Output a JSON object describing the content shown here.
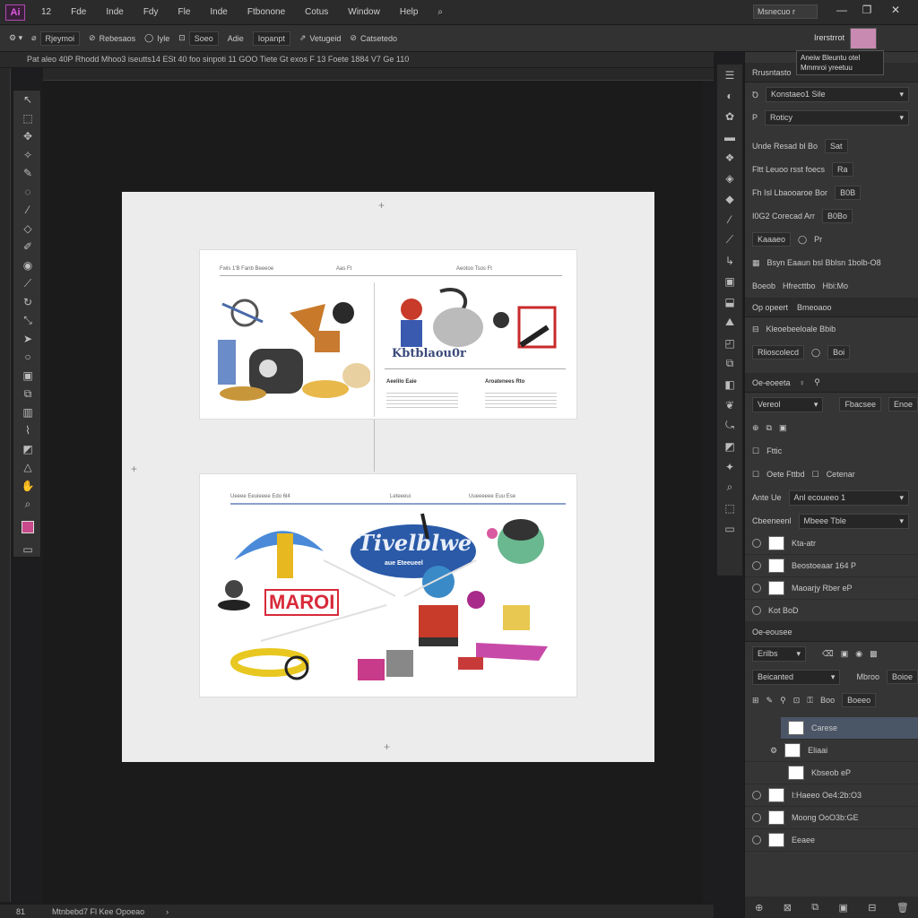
{
  "menubar": {
    "logo": "Ai",
    "items": [
      "12",
      "Fde",
      "Inde",
      "Fdy",
      "Fle",
      "Inde",
      "Ftbonone",
      "Cotus",
      "Window",
      "Help"
    ],
    "workspace": "Msnecuo r",
    "controls": [
      "—",
      "❐",
      "✕"
    ]
  },
  "options": {
    "items": [
      "Rjeymoi",
      "Rebesaos",
      "Iyle",
      "Soeo",
      "Adie",
      "Iopanpt",
      "Vetugeid",
      "Catsetedo"
    ],
    "right_label": "Irerstrrot"
  },
  "tooltip": {
    "line1": "Aneiw Bleuntu otel",
    "line2": "Mmmroi yreetuu"
  },
  "doc_tab": "Pat aleo 40P Rhodd Mhoo3 iseutts14 ESt 40 foo sinpoti 11 GOO Tiete Gt exos F 13 Foete 1884 V7 Ge 110",
  "artboard": {
    "card1": {
      "head_left": "Fwls 1'B Fanb Beeeoe",
      "head_mid": "Aas Ft",
      "head_right": "Aeotoo Tsos Ft",
      "title": "Kbtblaou0r",
      "col1_title": "Aeelilo Eaie",
      "col2_title": "Aroatenees Rto"
    },
    "card2": {
      "head_left": "Ueeee Eeuieeee Edo 6l4",
      "head_mid": "Leteeeui",
      "head_right": "Uueeeeee Euu Ese",
      "logo_text": "Tivelblwe",
      "logo_sub": "aue Eteeueel",
      "banner": "MAROI"
    }
  },
  "status": {
    "zoom": "81",
    "doc": "Mtnbebd7 Fl Kee Opoeao"
  },
  "panels": {
    "properties": {
      "tab": "Rrusntasto",
      "rows": [
        "Konstaeo1 Sile",
        "Roticy"
      ],
      "field_a_label": "Unde Resad bl Bo",
      "field_a_val": "Sat",
      "field_b_label": "Fltt  Leuoo rsst foecs",
      "field_b_val": "Ra",
      "field_c_label": "Fh  Isl Lbaooaroe Bor",
      "field_c_val": "B0B",
      "field_d_label": "I0G2  Corecad Arr",
      "field_d_val": "B0Bo",
      "sub_a": "Kaaaeo",
      "sub_b": "Pr",
      "field_e_label": "Bsyn Eaaun  bsl Bblsn 1bolb-O8",
      "mini": [
        "Boeob",
        "Hfrecttbo",
        "Hbi:Mo"
      ]
    },
    "align": {
      "tab1": "Op opeert",
      "tab2": "Bmeoaoo",
      "row1": "Kleoebeeloale Bbib",
      "row2": "Rlioscolecd",
      "row2_val": "Boi"
    },
    "appearance": {
      "tab": "Oe-eoeeta",
      "dd1": "Vereol",
      "dd2": "Fbacsee",
      "dd2_val": "Enoe",
      "opt1": "Fttic",
      "opt2": "Oete Fttbd",
      "opt3": "Cetenar",
      "dd3_label": "Ante Ue",
      "dd3": "Anl ecoueeo 1",
      "dd4_label": "Cbeeneenl",
      "dd4": "Mbeee Tble"
    },
    "swatches": [
      {
        "name": "Kta-atr"
      },
      {
        "name": "Beostoeaar  164 P"
      },
      {
        "name": "Maoarjy Rber  eP"
      },
      {
        "name": "Kot  BoD"
      }
    ],
    "layers": {
      "tab": "Oe-eousee",
      "filter": "Erilbs",
      "blend": "Beicanted",
      "opacity_label": "Mbroo",
      "opacity": "Boioe",
      "fill_label": "Boo",
      "fill": "Boeeo",
      "items": [
        {
          "name": "Carese",
          "selected": true
        },
        {
          "name": "Eliaai",
          "selected": false
        },
        {
          "name": "Kbseob  eP",
          "selected": false
        },
        {
          "name": "I:Haeeo  Oe4:2b:O3",
          "selected": false
        },
        {
          "name": "Moong  OoO3b:GE",
          "selected": false
        },
        {
          "name": "Eeaee",
          "selected": false
        }
      ]
    }
  },
  "colors": {
    "accent": "#b04ab0",
    "selection": "#4a5566"
  }
}
